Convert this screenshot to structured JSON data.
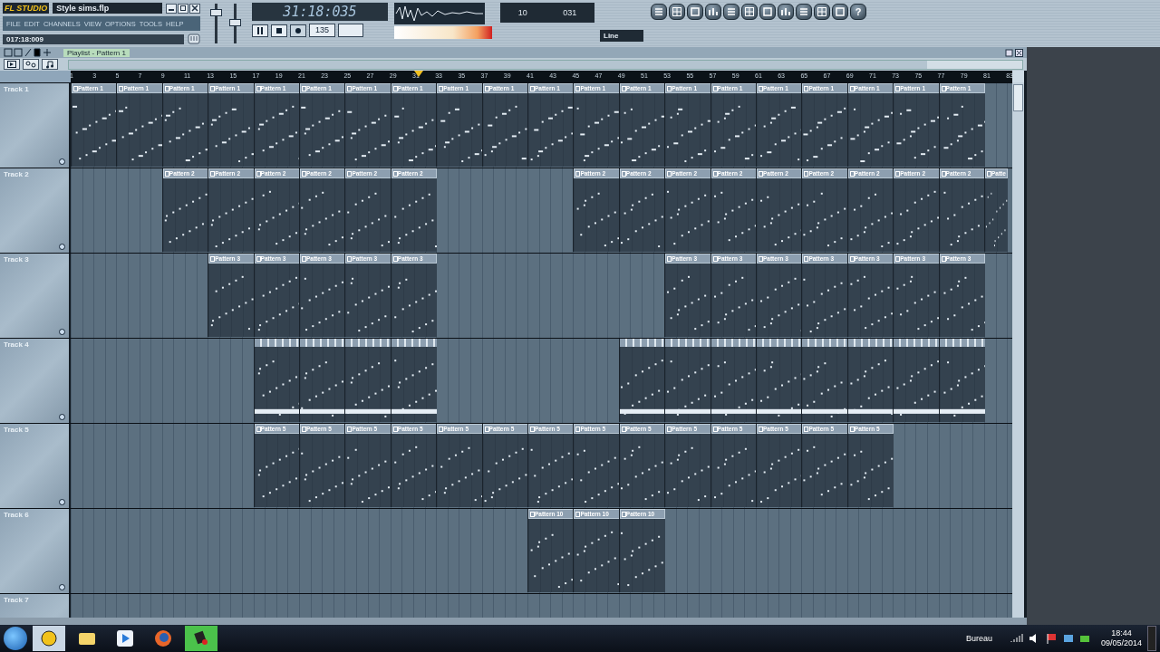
{
  "app": {
    "logo": "FL STUDIO",
    "file_title": "Style sims.flp",
    "menu": [
      "FILE",
      "EDIT",
      "CHANNELS",
      "VIEW",
      "OPTIONS",
      "TOOLS",
      "HELP"
    ],
    "hint": "017:18:009"
  },
  "master": {
    "volume": {
      "level": 0.8
    },
    "pitch": {
      "level": 0.5
    }
  },
  "transport": {
    "time": "31:18:035",
    "tempo": "135",
    "cpu": "10",
    "poly": "031",
    "snap": "Line",
    "help": "?"
  },
  "playlist": {
    "title": "Playlist - Pattern 1",
    "position": {
      "level": 0.37
    },
    "ruler": [
      "1",
      "3",
      "5",
      "7",
      "9",
      "11",
      "13",
      "15",
      "17",
      "19",
      "21",
      "23",
      "25",
      "27",
      "29",
      "31",
      "33",
      "35",
      "37",
      "39",
      "41",
      "43",
      "45",
      "47",
      "49",
      "51",
      "53",
      "55",
      "57",
      "59",
      "61",
      "63",
      "65",
      "67",
      "69",
      "71",
      "73",
      "75",
      "77",
      "79",
      "81",
      "83"
    ],
    "tracks": [
      {
        "name": "Track 1",
        "slots": [
          {
            "kind": "clip",
            "label": "Pattern 1"
          },
          {
            "kind": "clip",
            "label": "Pattern 1"
          },
          {
            "kind": "clip",
            "label": "Pattern 1"
          },
          {
            "kind": "clip",
            "label": "Pattern 1"
          },
          {
            "kind": "clip",
            "label": "Pattern 1"
          },
          {
            "kind": "clip",
            "label": "Pattern 1"
          },
          {
            "kind": "clip",
            "label": "Pattern 1"
          },
          {
            "kind": "clip",
            "label": "Pattern 1"
          },
          {
            "kind": "clip",
            "label": "Pattern 1"
          },
          {
            "kind": "clip",
            "label": "Pattern 1"
          },
          {
            "kind": "clip",
            "label": "Pattern 1"
          },
          {
            "kind": "clip",
            "label": "Pattern 1"
          },
          {
            "kind": "clip",
            "label": "Pattern 1"
          },
          {
            "kind": "clip",
            "label": "Pattern 1"
          },
          {
            "kind": "clip",
            "label": "Pattern 1"
          },
          {
            "kind": "clip",
            "label": "Pattern 1"
          },
          {
            "kind": "clip",
            "label": "Pattern 1"
          },
          {
            "kind": "clip",
            "label": "Pattern 1"
          },
          {
            "kind": "clip",
            "label": "Pattern 1"
          },
          {
            "kind": "clip",
            "label": "Pattern 1"
          }
        ]
      },
      {
        "name": "Track 2",
        "slots": [
          {
            "kind": "empty"
          },
          {
            "kind": "empty"
          },
          {
            "kind": "clip",
            "label": "Pattern 2"
          },
          {
            "kind": "clip",
            "label": "Pattern 2"
          },
          {
            "kind": "clip",
            "label": "Pattern 2"
          },
          {
            "kind": "clip",
            "label": "Pattern 2"
          },
          {
            "kind": "clip",
            "label": "Pattern 2"
          },
          {
            "kind": "clip",
            "label": "Pattern 2"
          },
          {
            "kind": "empty"
          },
          {
            "kind": "empty"
          },
          {
            "kind": "empty"
          },
          {
            "kind": "clip",
            "label": "Pattern 2"
          },
          {
            "kind": "clip",
            "label": "Pattern 2"
          },
          {
            "kind": "clip",
            "label": "Pattern 2"
          },
          {
            "kind": "clip",
            "label": "Pattern 2"
          },
          {
            "kind": "clip",
            "label": "Pattern 2"
          },
          {
            "kind": "clip",
            "label": "Pattern 2"
          },
          {
            "kind": "clip",
            "label": "Pattern 2"
          },
          {
            "kind": "clip",
            "label": "Pattern 2"
          },
          {
            "kind": "clip",
            "label": "Pattern 2"
          },
          {
            "kind": "partial",
            "label": "Patte"
          }
        ]
      },
      {
        "name": "Track 3",
        "slots": [
          {
            "kind": "empty"
          },
          {
            "kind": "empty"
          },
          {
            "kind": "empty"
          },
          {
            "kind": "clip",
            "label": "Pattern 3"
          },
          {
            "kind": "clip",
            "label": "Pattern 3"
          },
          {
            "kind": "clip",
            "label": "Pattern 3"
          },
          {
            "kind": "clip",
            "label": "Pattern 3"
          },
          {
            "kind": "clip",
            "label": "Pattern 3"
          },
          {
            "kind": "empty"
          },
          {
            "kind": "empty"
          },
          {
            "kind": "empty"
          },
          {
            "kind": "empty"
          },
          {
            "kind": "empty"
          },
          {
            "kind": "clip",
            "label": "Pattern 3"
          },
          {
            "kind": "clip",
            "label": "Pattern 3"
          },
          {
            "kind": "clip",
            "label": "Pattern 3"
          },
          {
            "kind": "clip",
            "label": "Pattern 3"
          },
          {
            "kind": "clip",
            "label": "Pattern 3"
          },
          {
            "kind": "clip",
            "label": "Pattern 3"
          },
          {
            "kind": "clip",
            "label": "Pattern 3"
          }
        ]
      },
      {
        "name": "Track 4",
        "slots": [
          {
            "kind": "empty"
          },
          {
            "kind": "empty"
          },
          {
            "kind": "empty"
          },
          {
            "kind": "empty"
          },
          {
            "kind": "unlabeled"
          },
          {
            "kind": "unlabeled"
          },
          {
            "kind": "unlabeled"
          },
          {
            "kind": "unlabeled"
          },
          {
            "kind": "empty"
          },
          {
            "kind": "empty"
          },
          {
            "kind": "empty"
          },
          {
            "kind": "empty"
          },
          {
            "kind": "unlabeled"
          },
          {
            "kind": "unlabeled"
          },
          {
            "kind": "unlabeled"
          },
          {
            "kind": "unlabeled"
          },
          {
            "kind": "unlabeled"
          },
          {
            "kind": "unlabeled"
          },
          {
            "kind": "unlabeled"
          },
          {
            "kind": "unlabeled"
          }
        ]
      },
      {
        "name": "Track 5",
        "slots": [
          {
            "kind": "empty"
          },
          {
            "kind": "empty"
          },
          {
            "kind": "empty"
          },
          {
            "kind": "empty"
          },
          {
            "kind": "clip",
            "label": "Pattern 5"
          },
          {
            "kind": "clip",
            "label": "Pattern 5"
          },
          {
            "kind": "clip",
            "label": "Pattern 5"
          },
          {
            "kind": "clip",
            "label": "Pattern 5"
          },
          {
            "kind": "clip",
            "label": "Pattern 5"
          },
          {
            "kind": "clip",
            "label": "Pattern 5"
          },
          {
            "kind": "clip",
            "label": "Pattern 5"
          },
          {
            "kind": "clip",
            "label": "Pattern 5"
          },
          {
            "kind": "clip",
            "label": "Pattern 5"
          },
          {
            "kind": "clip",
            "label": "Pattern 5"
          },
          {
            "kind": "clip",
            "label": "Pattern 5"
          },
          {
            "kind": "clip",
            "label": "Pattern 5"
          },
          {
            "kind": "clip",
            "label": "Pattern 5"
          },
          {
            "kind": "clip",
            "label": "Pattern 5"
          }
        ]
      },
      {
        "name": "Track 6",
        "slots": [
          {
            "kind": "empty"
          },
          {
            "kind": "empty"
          },
          {
            "kind": "empty"
          },
          {
            "kind": "empty"
          },
          {
            "kind": "empty"
          },
          {
            "kind": "empty"
          },
          {
            "kind": "empty"
          },
          {
            "kind": "empty"
          },
          {
            "kind": "empty"
          },
          {
            "kind": "empty"
          },
          {
            "kind": "clip",
            "label": "Pattern 10"
          },
          {
            "kind": "clip",
            "label": "Pattern 10"
          },
          {
            "kind": "clip",
            "label": "Pattern 10"
          }
        ]
      },
      {
        "name": "Track 7"
      }
    ]
  },
  "taskbar": {
    "desktop_label": "Bureau",
    "time": "18:44",
    "date": "09/05/2014"
  }
}
